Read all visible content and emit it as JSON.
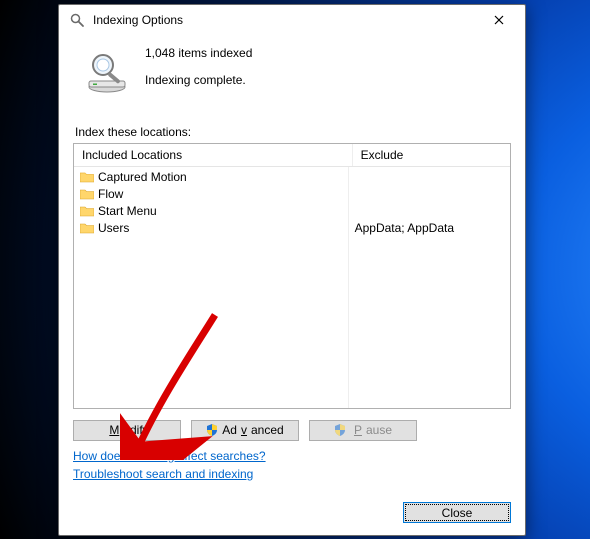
{
  "titlebar": {
    "title": "Indexing Options",
    "icon": "search-icon"
  },
  "status": {
    "count_line": "1,048 items indexed",
    "status_line": "Indexing complete."
  },
  "locations": {
    "section_label": "Index these locations:",
    "header_included": "Included Locations",
    "header_exclude": "Exclude",
    "items": [
      {
        "name": "Captured Motion",
        "exclude": ""
      },
      {
        "name": "Flow",
        "exclude": ""
      },
      {
        "name": "Start Menu",
        "exclude": ""
      },
      {
        "name": "Users",
        "exclude": "AppData; AppData"
      }
    ]
  },
  "buttons": {
    "modify": {
      "pre": "",
      "accel": "M",
      "post": "odify"
    },
    "advanced": {
      "pre": "Ad",
      "accel": "v",
      "post": "anced"
    },
    "pause": {
      "pre": "",
      "accel": "P",
      "post": "ause"
    },
    "close": "Close"
  },
  "links": {
    "help": "How does indexing affect searches?",
    "troubleshoot": "Troubleshoot search and indexing"
  }
}
